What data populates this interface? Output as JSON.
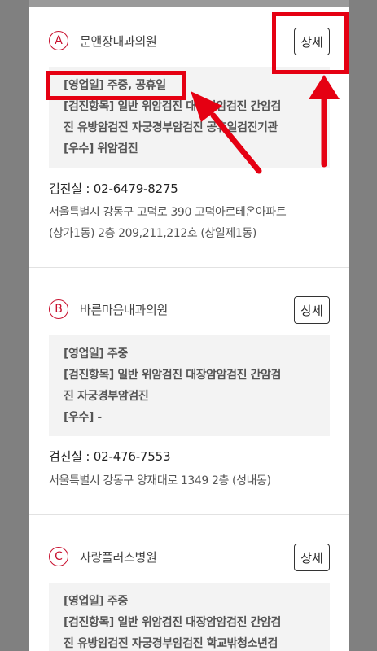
{
  "hospitals": [
    {
      "marker": "A",
      "name": "문앤장내과의원",
      "detail_label": "상세",
      "hours": "[영업일] 주중, 공휴일",
      "items_line1": "[검진항목] 일반 위암검진 대장암암검진 간암검",
      "items_line2": "진 유방암검진 자궁경부암검진 공휴일검진기관",
      "excellent": "[우수] 위암검진",
      "phone": "검진실 :  02-6479-8275",
      "address_line1": "서울특별시 강동구 고덕로 390 고덕아르테온아파트",
      "address_line2": "(상가1동) 2층 209,211,212호 (상일제1동)"
    },
    {
      "marker": "B",
      "name": "바른마음내과의원",
      "detail_label": "상세",
      "hours": "[영업일] 주중",
      "items_line1": "[검진항목] 일반 위암검진 대장암암검진 간암검",
      "items_line2": "진 자궁경부암검진",
      "excellent": "[우수] -",
      "phone": "검진실 :  02-476-7553",
      "address_line1": "서울특별시 강동구 양재대로 1349 2층 (성내동)"
    },
    {
      "marker": "C",
      "name": "사랑플러스병원",
      "detail_label": "상세",
      "hours": "[영업일] 주중",
      "items_line1": "[검진항목] 일반 위암검진 대장암암검진 간암검",
      "items_line2": "진 유방암검진 자궁경부암검진 학교밖청소년검"
    }
  ],
  "colors": {
    "marker": "#c8102e",
    "highlight": "#e50012"
  },
  "icons": {
    "highlight_arrow": "arrow-up-icon"
  }
}
